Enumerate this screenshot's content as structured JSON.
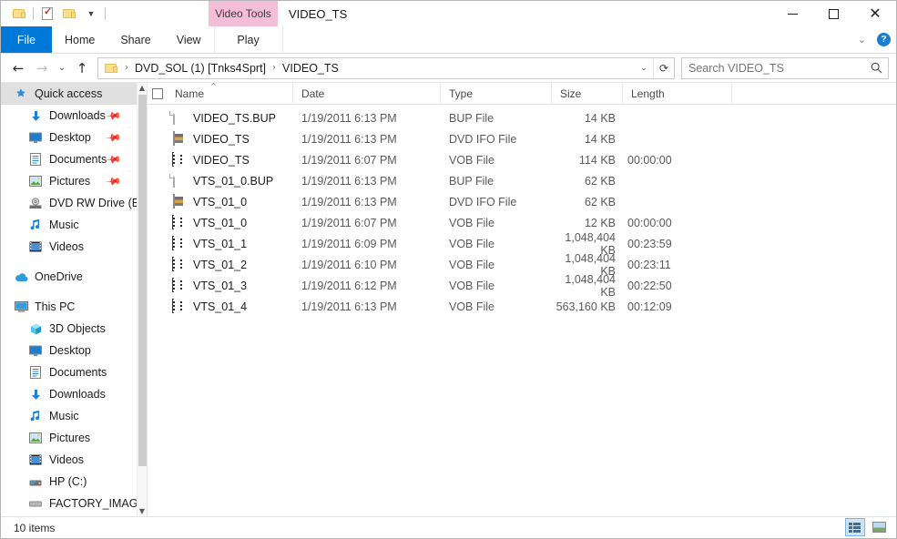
{
  "window": {
    "title": "VIDEO_TS",
    "contextual_group": "Video Tools",
    "minimize_label": "Minimize",
    "maximize_label": "Maximize",
    "close_label": "Close"
  },
  "quick_access_toolbar": {
    "items": [
      {
        "name": "folder-icon",
        "label": "Customize Quick Access Toolbar"
      },
      {
        "name": "properties-icon",
        "label": "Properties"
      },
      {
        "name": "new-folder-icon",
        "label": "New folder"
      },
      {
        "name": "chevron-down-icon",
        "label": "Customize"
      }
    ]
  },
  "ribbon": {
    "tabs": [
      {
        "label": "File",
        "selected": true
      },
      {
        "label": "Home",
        "selected": false
      },
      {
        "label": "Share",
        "selected": false
      },
      {
        "label": "View",
        "selected": false
      },
      {
        "label": "Play",
        "selected": false,
        "contextual": true
      }
    ],
    "collapse_label": "Expand the Ribbon",
    "help_label": "?"
  },
  "address_bar": {
    "back_label": "Back",
    "forward_label": "Forward",
    "recent_label": "Recent locations",
    "up_label": "Up to DVD_SOL (1) [Tnks4Sprt]",
    "breadcrumbs": [
      "DVD_SOL (1) [Tnks4Sprt]",
      "VIDEO_TS"
    ],
    "separator": "›",
    "dropdown_label": "Previous locations",
    "refresh_label": "Refresh"
  },
  "search": {
    "placeholder": "Search VIDEO_TS",
    "value": "",
    "icon": "search-icon"
  },
  "sidebar": {
    "groups": [
      {
        "name": "quick-access",
        "header": {
          "label": "Quick access",
          "icon": "star-pin-icon",
          "selected": true
        },
        "items": [
          {
            "label": "Downloads",
            "icon": "download-icon",
            "pinned": true
          },
          {
            "label": "Desktop",
            "icon": "desktop-icon",
            "pinned": true
          },
          {
            "label": "Documents",
            "icon": "documents-icon",
            "pinned": true
          },
          {
            "label": "Pictures",
            "icon": "pictures-icon",
            "pinned": true
          },
          {
            "label": "DVD RW Drive (E",
            "icon": "dvd-drive-icon",
            "pinned": false
          },
          {
            "label": "Music",
            "icon": "music-icon",
            "pinned": false
          },
          {
            "label": "Videos",
            "icon": "videos-icon",
            "pinned": false
          }
        ]
      },
      {
        "name": "onedrive",
        "header": {
          "label": "OneDrive",
          "icon": "onedrive-icon",
          "selected": false
        },
        "items": []
      },
      {
        "name": "this-pc",
        "header": {
          "label": "This PC",
          "icon": "this-pc-icon",
          "selected": false
        },
        "items": [
          {
            "label": "3D Objects",
            "icon": "3d-objects-icon",
            "pinned": false
          },
          {
            "label": "Desktop",
            "icon": "desktop-icon",
            "pinned": false
          },
          {
            "label": "Documents",
            "icon": "documents-icon",
            "pinned": false
          },
          {
            "label": "Downloads",
            "icon": "download-icon",
            "pinned": false
          },
          {
            "label": "Music",
            "icon": "music-icon",
            "pinned": false
          },
          {
            "label": "Pictures",
            "icon": "pictures-icon",
            "pinned": false
          },
          {
            "label": "Videos",
            "icon": "videos-icon",
            "pinned": false
          },
          {
            "label": "HP (C:)",
            "icon": "hard-drive-icon",
            "pinned": false
          },
          {
            "label": "FACTORY_IMAG",
            "icon": "hard-drive-icon",
            "pinned": false
          }
        ]
      }
    ],
    "scroll_up_label": "Scroll up",
    "scroll_down_label": "Scroll down"
  },
  "file_list": {
    "select_all_label": "Select all",
    "columns": [
      {
        "label": "Name",
        "sorted": "asc"
      },
      {
        "label": "Date",
        "sorted": ""
      },
      {
        "label": "Type",
        "sorted": ""
      },
      {
        "label": "Size",
        "sorted": ""
      },
      {
        "label": "Length",
        "sorted": ""
      }
    ],
    "sort_caret": "^",
    "rows": [
      {
        "name": "VIDEO_TS.BUP",
        "date": "1/19/2011 6:13 PM",
        "type": "BUP File",
        "size": "14 KB",
        "length": "",
        "icon": "blank-file-icon"
      },
      {
        "name": "VIDEO_TS",
        "date": "1/19/2011 6:13 PM",
        "type": "DVD IFO File",
        "size": "14 KB",
        "length": "",
        "icon": "ifo-file-icon"
      },
      {
        "name": "VIDEO_TS",
        "date": "1/19/2011 6:07 PM",
        "type": "VOB File",
        "size": "114 KB",
        "length": "00:00:00",
        "icon": "vob-file-icon"
      },
      {
        "name": "VTS_01_0.BUP",
        "date": "1/19/2011 6:13 PM",
        "type": "BUP File",
        "size": "62 KB",
        "length": "",
        "icon": "blank-file-icon"
      },
      {
        "name": "VTS_01_0",
        "date": "1/19/2011 6:13 PM",
        "type": "DVD IFO File",
        "size": "62 KB",
        "length": "",
        "icon": "ifo-file-icon"
      },
      {
        "name": "VTS_01_0",
        "date": "1/19/2011 6:07 PM",
        "type": "VOB File",
        "size": "12 KB",
        "length": "00:00:00",
        "icon": "vob-file-icon"
      },
      {
        "name": "VTS_01_1",
        "date": "1/19/2011 6:09 PM",
        "type": "VOB File",
        "size": "1,048,404 KB",
        "length": "00:23:59",
        "icon": "vob-file-icon"
      },
      {
        "name": "VTS_01_2",
        "date": "1/19/2011 6:10 PM",
        "type": "VOB File",
        "size": "1,048,404 KB",
        "length": "00:23:11",
        "icon": "vob-file-icon"
      },
      {
        "name": "VTS_01_3",
        "date": "1/19/2011 6:12 PM",
        "type": "VOB File",
        "size": "1,048,404 KB",
        "length": "00:22:50",
        "icon": "vob-file-icon"
      },
      {
        "name": "VTS_01_4",
        "date": "1/19/2011 6:13 PM",
        "type": "VOB File",
        "size": "563,160 KB",
        "length": "00:12:09",
        "icon": "vob-file-icon"
      }
    ]
  },
  "status_bar": {
    "items_text": "10 items",
    "views": [
      {
        "name": "details-view",
        "label": "Details view",
        "active": true
      },
      {
        "name": "large-icons-view",
        "label": "Large icons view",
        "active": false
      }
    ]
  },
  "colors": {
    "accent": "#0078d7",
    "contextual_pink": "#f3bed6",
    "selection_gray": "#e0e0e0",
    "view_active": "#cce4f7"
  }
}
